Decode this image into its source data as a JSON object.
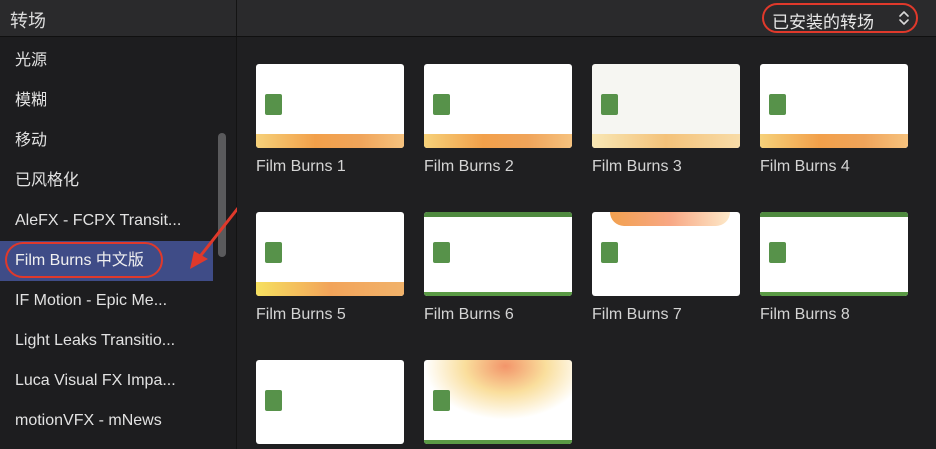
{
  "header": {
    "title": "转场",
    "filter_label": "已安装的转场",
    "filter_icon": "up-down-chevron-icon"
  },
  "sidebar": {
    "items": [
      {
        "label": "光源"
      },
      {
        "label": "模糊"
      },
      {
        "label": "移动"
      },
      {
        "label": "已风格化"
      },
      {
        "label": "AleFX - FCPX Transit..."
      },
      {
        "label": "Film Burns 中文版",
        "selected": true
      },
      {
        "label": "IF Motion - Epic Me..."
      },
      {
        "label": "Light Leaks Transitio..."
      },
      {
        "label": "Luca Visual FX Impa..."
      },
      {
        "label": "motionVFX - mNews"
      }
    ]
  },
  "grid": {
    "items": [
      {
        "label": "Film Burns 1"
      },
      {
        "label": "Film Burns 2"
      },
      {
        "label": "Film Burns 3"
      },
      {
        "label": "Film Burns 4"
      },
      {
        "label": "Film Burns 5"
      },
      {
        "label": "Film Burns 6"
      },
      {
        "label": "Film Burns 7"
      },
      {
        "label": "Film Burns 8"
      },
      {
        "label": ""
      },
      {
        "label": ""
      }
    ]
  },
  "colors": {
    "accent_selected": "#3f4c87",
    "highlight_ring": "#e0392b",
    "chip_green": "#57924a"
  }
}
